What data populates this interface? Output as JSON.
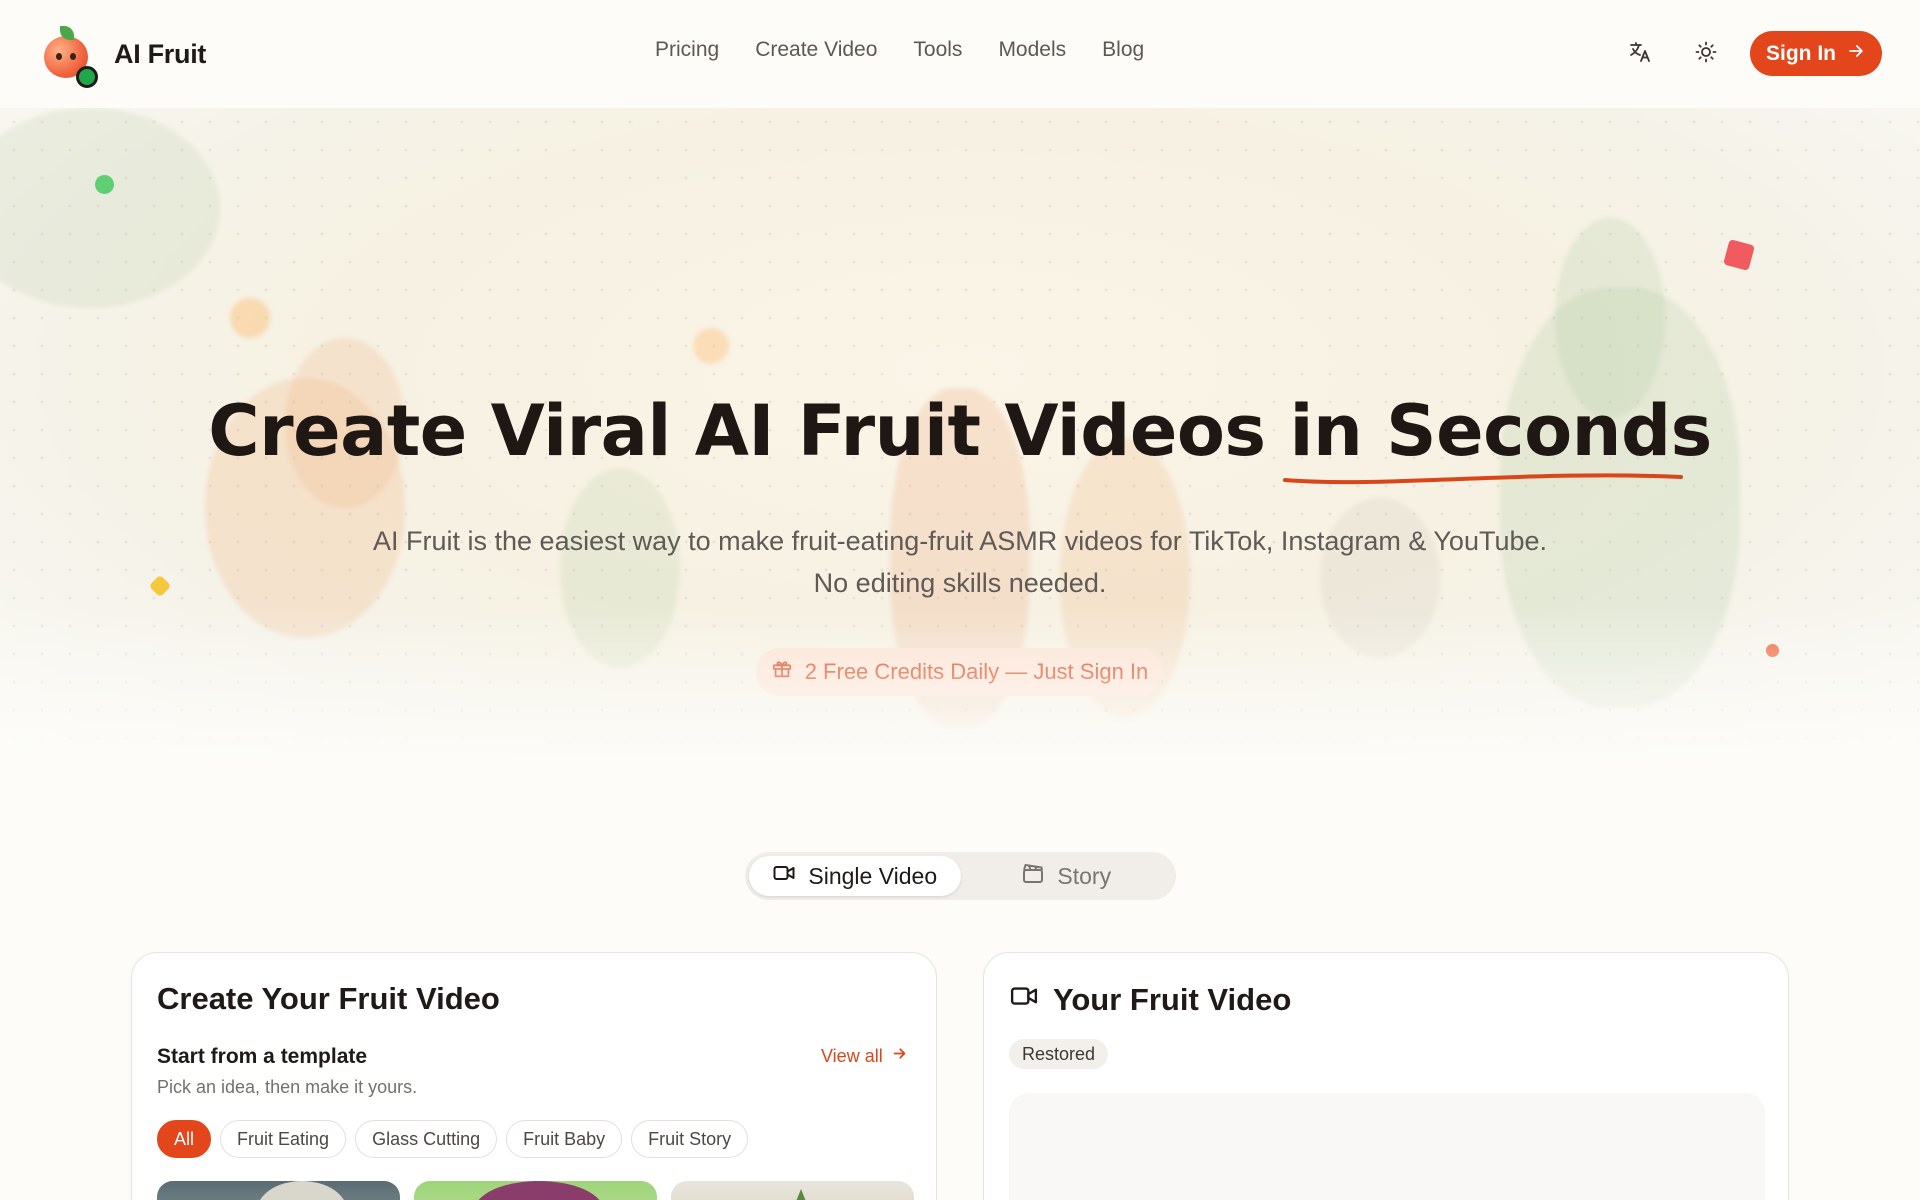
{
  "brand": {
    "name": "AI Fruit"
  },
  "nav": {
    "items": [
      {
        "label": "Pricing"
      },
      {
        "label": "Create Video"
      },
      {
        "label": "Tools"
      },
      {
        "label": "Models"
      },
      {
        "label": "Blog"
      }
    ]
  },
  "header": {
    "sign_in_label": "Sign In"
  },
  "hero": {
    "title_main": "Create Viral AI Fruit Videos",
    "title_highlight": "in Seconds",
    "subtitle_line1": "AI Fruit is the easiest way to make fruit-eating-fruit ASMR videos for TikTok, Instagram & YouTube.",
    "subtitle_line2": "No editing skills needed.",
    "credits_label": "2 Free Credits Daily — Just Sign In"
  },
  "mode_toggle": {
    "tabs": [
      {
        "label": "Single Video",
        "active": true
      },
      {
        "label": "Story",
        "active": false
      }
    ]
  },
  "create_card": {
    "title": "Create Your Fruit Video",
    "template_title": "Start from a template",
    "template_subtitle": "Pick an idea, then make it yours.",
    "view_all_label": "View all",
    "chips": [
      {
        "label": "All",
        "active": true
      },
      {
        "label": "Fruit Eating",
        "active": false
      },
      {
        "label": "Glass Cutting",
        "active": false
      },
      {
        "label": "Fruit Baby",
        "active": false
      },
      {
        "label": "Fruit Story",
        "active": false
      }
    ]
  },
  "result_card": {
    "title": "Your Fruit Video",
    "status_badge": "Restored"
  },
  "colors": {
    "accent": "#e2461a",
    "accent_soft": "#fde3d4",
    "background": "#fdfcf9"
  },
  "icons": {
    "translate": "translate-icon",
    "theme": "sun-icon",
    "arrow": "arrow-right-icon",
    "gift": "gift-icon",
    "video": "video-camera-icon",
    "story": "clapperboard-icon"
  }
}
